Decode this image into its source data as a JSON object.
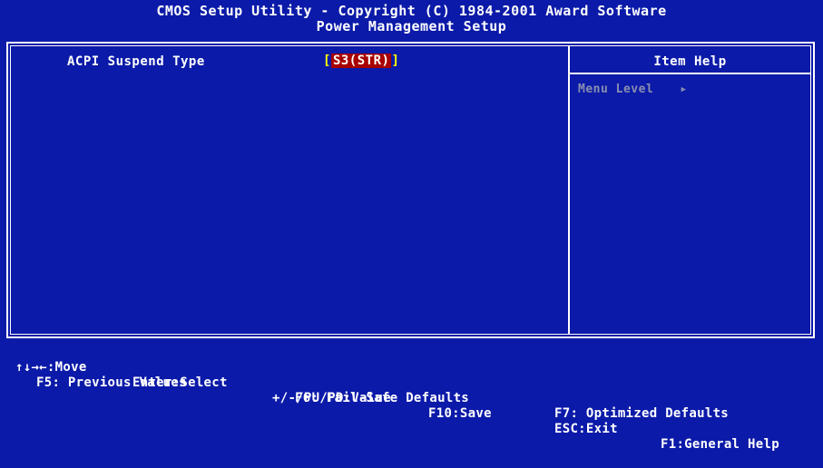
{
  "header": {
    "title": "CMOS Setup Utility - Copyright (C) 1984-2001 Award Software",
    "subtitle": "Power Management Setup"
  },
  "settings": [
    {
      "label": "ACPI Suspend Type",
      "value": "S3(STR)"
    }
  ],
  "help": {
    "title": "Item Help",
    "menu_level_label": "Menu Level",
    "menu_level_arrow": "▶"
  },
  "footer": {
    "row1": {
      "move": "↑↓→←:Move",
      "enter": "Enter:Select",
      "value": "+/-/PU/PD:Value",
      "f10": "F10:Save",
      "esc": "ESC:Exit",
      "f1": "F1:General Help"
    },
    "row2": {
      "f5": "F5: Previous Values",
      "f6": "F6: Fail-Safe Defaults",
      "f7": "F7: Optimized Defaults"
    }
  },
  "colors": {
    "background": "#0b1aa8",
    "text": "#ffffff",
    "value_highlight_bg": "#a80000",
    "value_bracket": "#ffff00",
    "inactive_help_text": "#8a8fb0"
  }
}
